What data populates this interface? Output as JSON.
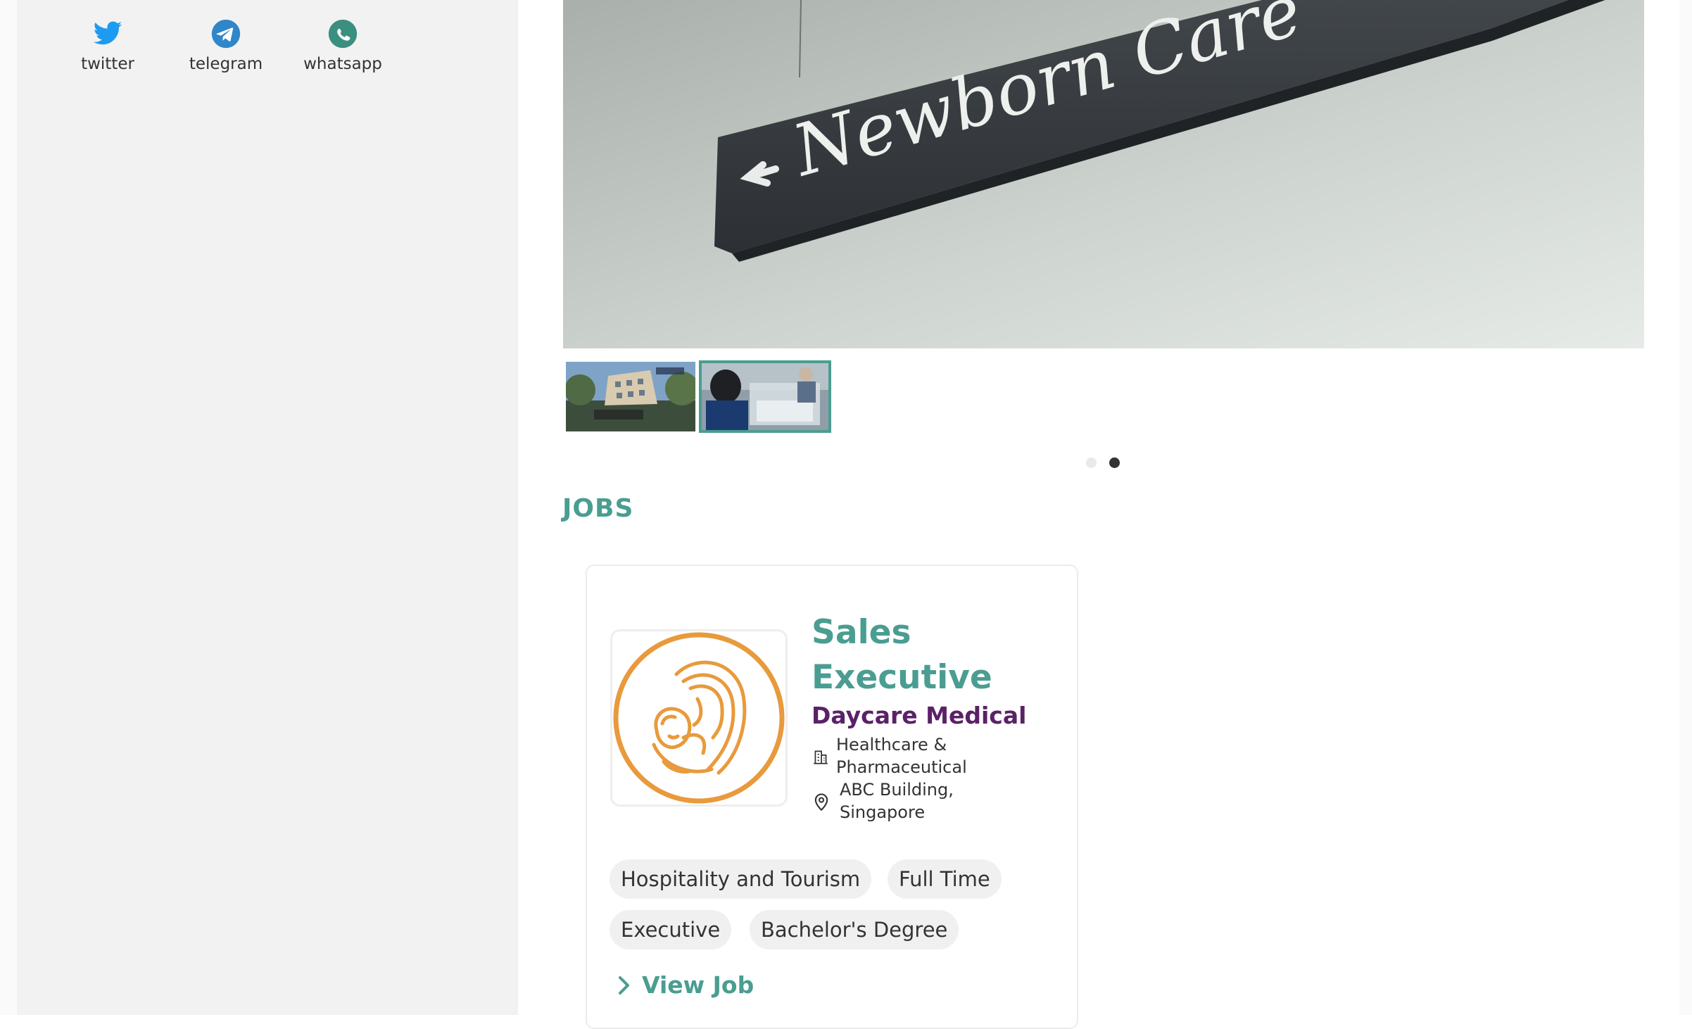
{
  "share": {
    "items": [
      {
        "label": "twitter",
        "icon": "twitter-icon",
        "color": "#1d9bf0"
      },
      {
        "label": "telegram",
        "icon": "telegram-icon",
        "color": "#2f86c8"
      },
      {
        "label": "whatsapp",
        "icon": "whatsapp-icon",
        "color": "#3a8f7f"
      }
    ]
  },
  "gallery": {
    "hero_sign": {
      "text": "Newborn Care",
      "arrow": "left-arrow-icon"
    },
    "thumbnails": 2,
    "active_index": 1,
    "dots": 2,
    "active_dot": 1
  },
  "jobs": {
    "heading": "JOBS",
    "card": {
      "title": "Sales Executive",
      "company": "Daycare Medical",
      "industry": "Healthcare & Pharmaceutical",
      "location": "ABC Building, Singapore",
      "tags": [
        "Hospitality and Tourism",
        "Full Time",
        "Executive",
        "Bachelor's Degree"
      ],
      "cta": "View Job"
    }
  },
  "colors": {
    "accent": "#4a9d91",
    "company": "#5b2167",
    "logo": "#e89a3c",
    "sidebar_bg": "#f2f2f2",
    "tag_bg": "#f0f0f0"
  }
}
